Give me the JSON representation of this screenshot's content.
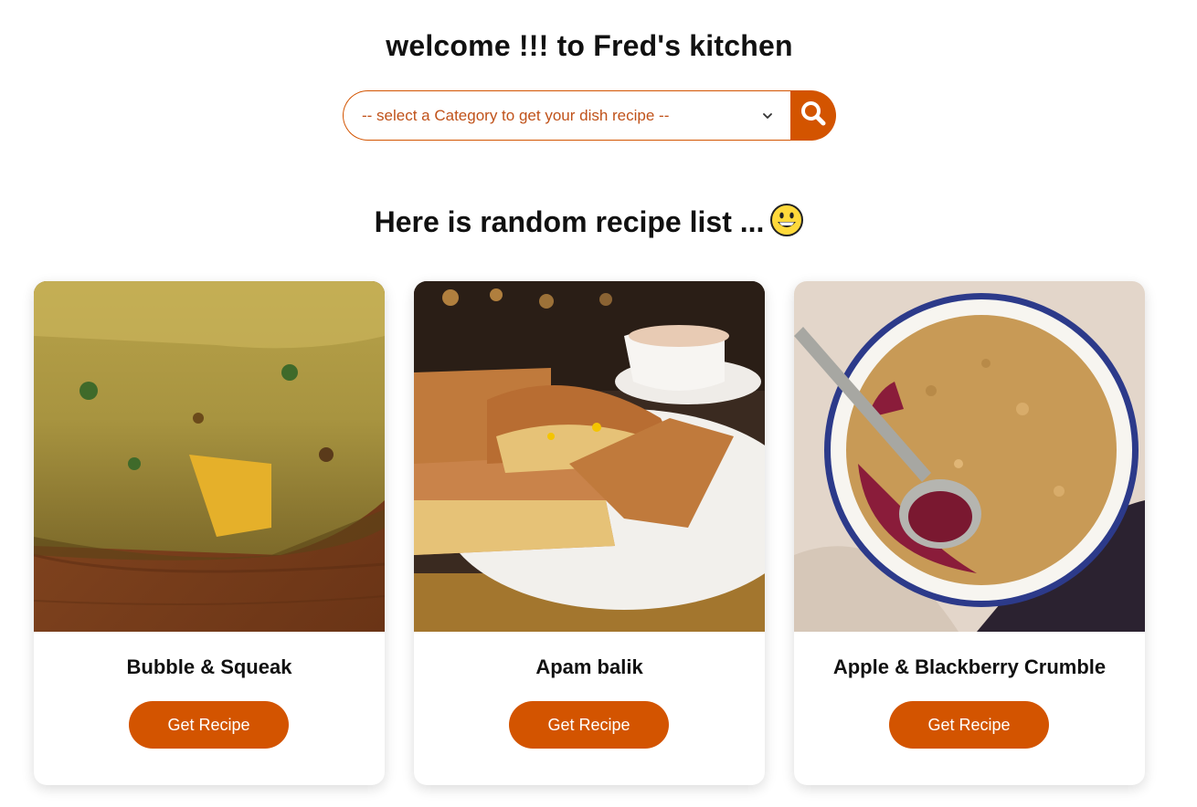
{
  "header": {
    "welcome": "welcome !!! to Fred's kitchen"
  },
  "search": {
    "select_placeholder": "-- select a Category to get your dish recipe --",
    "chevron_icon": "chevron-down-icon",
    "button_icon": "search-icon"
  },
  "main": {
    "subheading": "Here is random recipe list ...",
    "emoji": "grinning-face-icon"
  },
  "recipes": [
    {
      "name": "Bubble & Squeak",
      "button_label": "Get Recipe",
      "image": "bubble-and-squeak-photo"
    },
    {
      "name": "Apam balik",
      "button_label": "Get Recipe",
      "image": "apam-balik-photo"
    },
    {
      "name": "Apple & Blackberry Crumble",
      "button_label": "Get Recipe",
      "image": "crumble-photo"
    }
  ],
  "colors": {
    "accent": "#d35400",
    "select_text": "#c0521a",
    "text": "#111111",
    "background": "#ffffff"
  }
}
